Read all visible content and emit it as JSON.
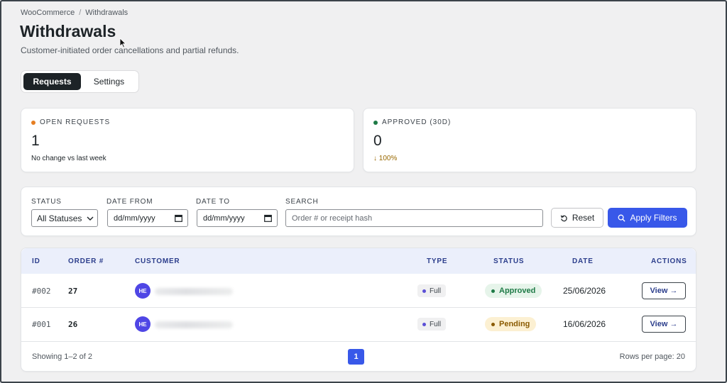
{
  "breadcrumb": {
    "root": "WooCommerce",
    "separator": "/",
    "current": "Withdrawals"
  },
  "page": {
    "title": "Withdrawals",
    "subtitle": "Customer-initiated order cancellations and partial refunds."
  },
  "tabs": [
    {
      "label": "Requests",
      "active": true
    },
    {
      "label": "Settings",
      "active": false
    }
  ],
  "stats": {
    "open": {
      "label": "OPEN REQUESTS",
      "value": "1",
      "note": "No change vs last week",
      "dot_color": "#e67e22"
    },
    "approved": {
      "label": "APPROVED (30D)",
      "value": "0",
      "note": "↓ 100%",
      "dot_color": "#1e7a46",
      "note_color": "#996800"
    }
  },
  "filters": {
    "status_label": "STATUS",
    "status_value": "All Statuses",
    "date_from_label": "DATE FROM",
    "date_from_placeholder": "dd/mm/yyyy",
    "date_to_label": "DATE TO",
    "date_to_placeholder": "dd/mm/yyyy",
    "search_label": "SEARCH",
    "search_placeholder": "Order # or receipt hash",
    "reset_label": "Reset",
    "apply_label": "Apply Filters"
  },
  "table": {
    "columns": {
      "id": "ID",
      "order": "ORDER #",
      "customer": "CUSTOMER",
      "type": "TYPE",
      "status": "STATUS",
      "date": "DATE",
      "actions": "ACTIONS"
    },
    "rows": [
      {
        "id": "#002",
        "order": "27",
        "avatar": "HE",
        "type": "Full",
        "status": "Approved",
        "date": "25/06/2026",
        "action": "View →"
      },
      {
        "id": "#001",
        "order": "26",
        "avatar": "HE",
        "type": "Full",
        "status": "Pending",
        "date": "16/06/2026",
        "action": "View →"
      }
    ],
    "showing": "Showing 1–2 of 2",
    "current_page": "1",
    "rows_per_page": "Rows per page: 20"
  },
  "colors": {
    "accent": "#3858e9",
    "approved_bg": "#e6f4ea",
    "approved_fg": "#1e7a46",
    "pending_bg": "#fcf0d2",
    "pending_fg": "#8a5a00",
    "type_dot": "#5b4fd6"
  }
}
